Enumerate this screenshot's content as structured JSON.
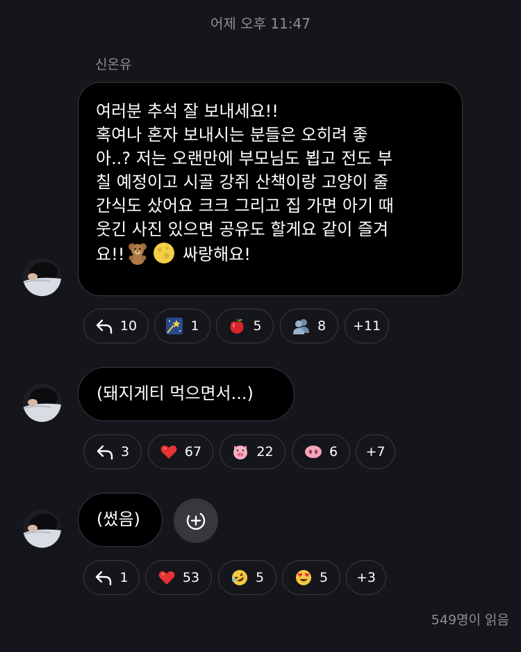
{
  "timestamp": "어제 오후 11:47",
  "sender": "신온유",
  "messages": [
    {
      "lines": [
        "여러분 추석 잘 보내세요!!",
        "혹여나 혼자 보내시는 분들은 오히려 좋",
        "아..? 저는 오랜만에 부모님도 뵙고 전도 부",
        "칠 예정이고 시골 강쥐 산책이랑 고양이 줄",
        "간식도 샀어요 크크 그리고 집 가면 아기 때",
        "웃긴 사진 있으면 공유도 할게요 같이 즐겨"
      ],
      "last_line_start": "요!!",
      "last_line_end": "싸랑해요!",
      "inline_emojis": [
        "teddy-bear",
        "full-moon"
      ],
      "reactions": [
        {
          "icon": "reply-icon",
          "count": "10"
        },
        {
          "icon": "stars-emoji",
          "count": "1"
        },
        {
          "icon": "apple-emoji",
          "count": "5"
        },
        {
          "icon": "busts-emoji",
          "count": "8"
        },
        {
          "more": "+11"
        }
      ]
    },
    {
      "text": "(돼지게티 먹으면서...)",
      "reactions": [
        {
          "icon": "reply-icon",
          "count": "3"
        },
        {
          "icon": "heart-emoji",
          "count": "67"
        },
        {
          "icon": "pig-face-emoji",
          "count": "22"
        },
        {
          "icon": "pig-nose-emoji",
          "count": "6"
        },
        {
          "more": "+7"
        }
      ]
    },
    {
      "text": "(썼음)",
      "reactions": [
        {
          "icon": "reply-icon",
          "count": "1"
        },
        {
          "icon": "heart-emoji",
          "count": "53"
        },
        {
          "icon": "rofl-emoji",
          "count": "5"
        },
        {
          "icon": "heart-eyes-emoji",
          "count": "5"
        },
        {
          "more": "+3"
        }
      ]
    }
  ],
  "read_receipt": "549명이 읽음",
  "colors": {
    "background": "#15161b",
    "bubble": "#000000",
    "border": "#3a3b42",
    "muted_text": "#8e8f96"
  }
}
